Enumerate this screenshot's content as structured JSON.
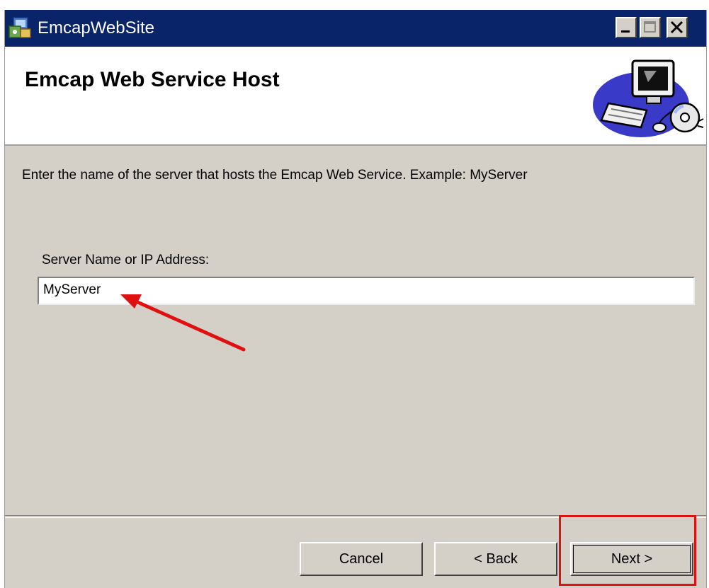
{
  "window": {
    "title": "EmcapWebSite",
    "icon": "installer-icon",
    "controls": [
      "minimize-icon",
      "maximize-icon",
      "close-icon"
    ]
  },
  "banner": {
    "title": "Emcap Web Service Host",
    "art": "computer-with-disc-illustration"
  },
  "body": {
    "instruction": "Enter the name of the server that hosts the Emcap Web Service. Example: MyServer",
    "field_label": "Server Name or IP Address:",
    "field_value": "MyServer"
  },
  "buttons": {
    "cancel": "Cancel",
    "back": "< Back",
    "next": "Next >"
  },
  "annotations": {
    "arrow_color": "#e01010",
    "highlight_color": "#e01010"
  },
  "colors": {
    "titlebar": "#0a246a",
    "dialog_bg": "#d4d0c8"
  }
}
